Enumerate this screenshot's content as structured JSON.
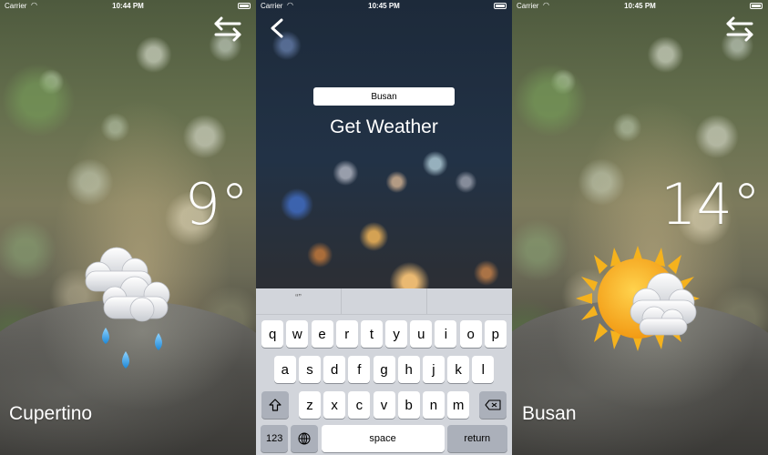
{
  "status_bar": {
    "carrier": "Carrier",
    "left_time": "10:44 PM",
    "middle_time": "10:45 PM",
    "right_time": "10:45 PM"
  },
  "left_screen": {
    "temperature": "9°",
    "city": "Cupertino",
    "condition_icon": "rain-cloud-icon",
    "switch_icon": "switch-city-icon"
  },
  "middle_screen": {
    "city_input_value": "Busan",
    "get_weather_label": "Get Weather",
    "back_icon": "back-chevron-icon",
    "suggestion_bar": [
      "“”",
      "",
      ""
    ],
    "keyboard": {
      "row1": [
        "q",
        "w",
        "e",
        "r",
        "t",
        "y",
        "u",
        "i",
        "o",
        "p"
      ],
      "row2": [
        "a",
        "s",
        "d",
        "f",
        "g",
        "h",
        "j",
        "k",
        "l"
      ],
      "row3": [
        "z",
        "x",
        "c",
        "v",
        "b",
        "n",
        "m"
      ],
      "number_key": "123",
      "space_key": "space",
      "return_key": "return"
    }
  },
  "right_screen": {
    "temperature": "14°",
    "city": "Busan",
    "condition_icon": "sun-cloud-icon",
    "switch_icon": "switch-city-icon"
  }
}
